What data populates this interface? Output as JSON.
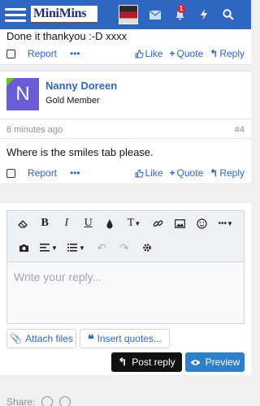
{
  "header": {
    "logo_text": "MiniMins",
    "alerts_count": "1"
  },
  "post1": {
    "text": "Done it thankyou :-D xxxx",
    "actions": {
      "report": "Report",
      "more": "•••",
      "like": "Like",
      "quote": "Quote",
      "reply": "Reply"
    }
  },
  "post2": {
    "avatar_letter": "N",
    "username": "Nanny Doreen",
    "user_title": "Gold Member",
    "time": "6 minutes ago",
    "post_number": "#4",
    "text": "Where is the smiles tab please.",
    "actions": {
      "report": "Report",
      "more": "•••",
      "like": "Like",
      "quote": "Quote",
      "reply": "Reply"
    }
  },
  "editor": {
    "placeholder": "Write your reply...",
    "toolbar": {
      "bold": "B",
      "italic": "I",
      "underline": "U",
      "text_size": "T",
      "more": "•••"
    },
    "attach_label": "Attach files",
    "insert_quotes_label": "Insert quotes...",
    "post_reply_label": "Post reply",
    "preview_label": "Preview"
  },
  "footer": {
    "share_label": "Share:"
  },
  "colors": {
    "brand": "#2f66c1",
    "dark_button": "#111111",
    "preview_button": "#2f7fc9",
    "badge": "#d6252b"
  }
}
